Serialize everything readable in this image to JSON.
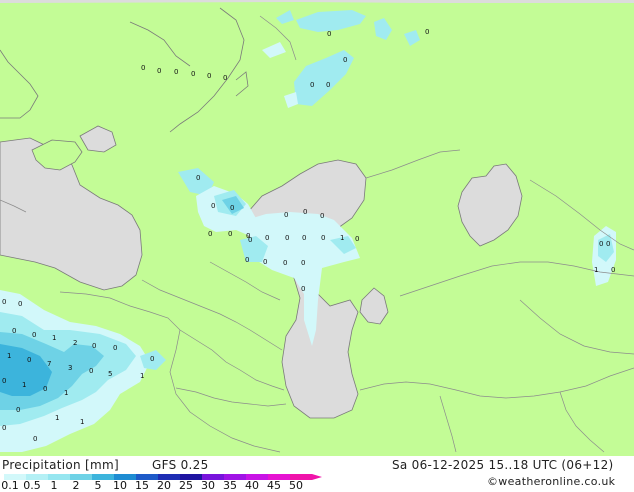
{
  "map": {
    "colors": {
      "land": "#c3fc96",
      "water": "#dcdcdc",
      "precip_light": "#d2f8fa",
      "precip_mid": "#a0ebf0",
      "precip_heavy": "#6ed2e6",
      "precip_strong": "#3cb4dc",
      "border": "#8c8c8c",
      "coast": "#7a7a7a"
    }
  },
  "legend": {
    "product": "Precipitation [mm]",
    "model": "GFS 0.25",
    "valid": "Sa 06-12-2025 15..18 UTC (06+12)",
    "credit": "©weatheronline.co.uk",
    "scale": [
      {
        "label": "0.1",
        "color": "#d2f8fa"
      },
      {
        "label": "0.5",
        "color": "#b4f0f5"
      },
      {
        "label": "1",
        "color": "#96e6f0"
      },
      {
        "label": "2",
        "color": "#6ed2e6"
      },
      {
        "label": "5",
        "color": "#3cb4dc"
      },
      {
        "label": "10",
        "color": "#1e8cd2"
      },
      {
        "label": "15",
        "color": "#1e5ac8"
      },
      {
        "label": "20",
        "color": "#1e2db4"
      },
      {
        "label": "25",
        "color": "#1e14a0"
      },
      {
        "label": "30",
        "color": "#7814dc"
      },
      {
        "label": "35",
        "color": "#a014e6"
      },
      {
        "label": "40",
        "color": "#c814e6"
      },
      {
        "label": "45",
        "color": "#e614d2"
      },
      {
        "label": "50",
        "color": "#f014aa"
      }
    ]
  },
  "point_values": [
    "0",
    "0",
    "0",
    "0",
    "0",
    "0",
    "0",
    "0",
    "0",
    "0",
    "0",
    "0",
    "0",
    "0",
    "0",
    "0",
    "0",
    "0",
    "0",
    "0",
    "0",
    "0",
    "0",
    "1",
    "0",
    "0",
    "0",
    "0",
    "0",
    "0",
    "0",
    "0",
    "0",
    "0",
    "1",
    "0",
    "0",
    "0",
    "0",
    "0",
    "1",
    "2",
    "0",
    "0",
    "1",
    "0",
    "7",
    "3",
    "0",
    "5",
    "0",
    "1",
    "0",
    "1",
    "0",
    "1",
    "0",
    "0",
    "1",
    "0",
    "1"
  ]
}
